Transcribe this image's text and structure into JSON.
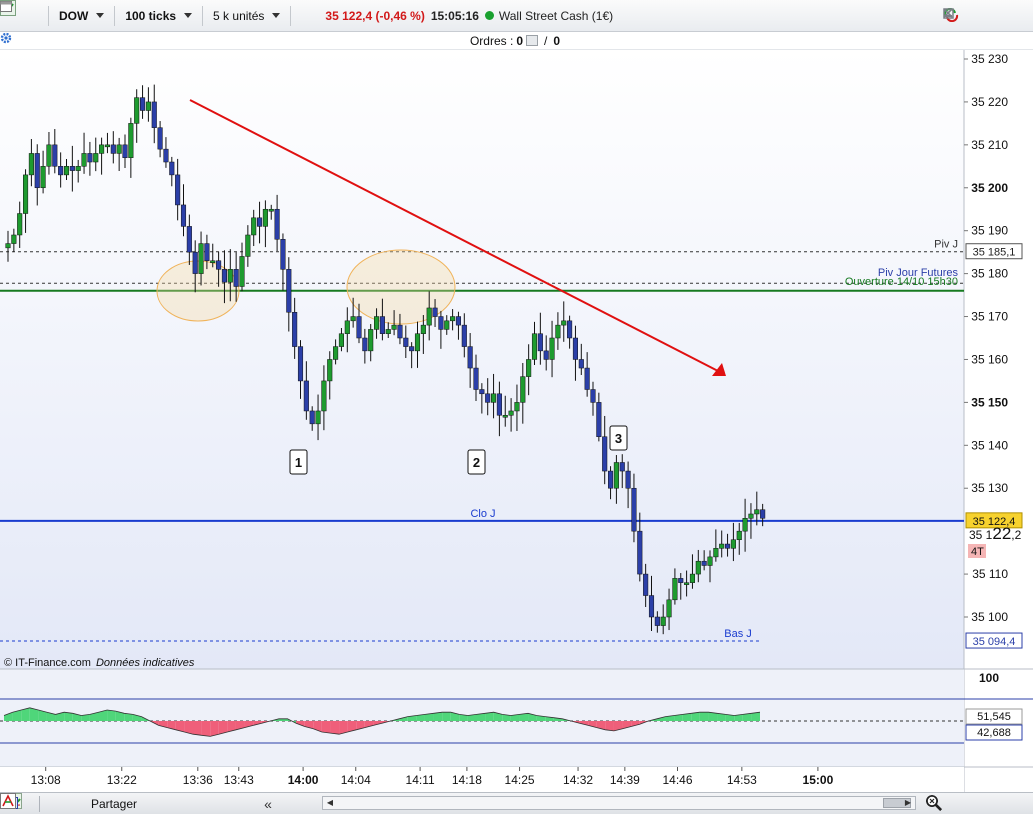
{
  "toolbar": {
    "instrument": "DOW",
    "ticks": "100 ticks",
    "units": "5 k unités",
    "price_change": "35 122,4 (-0,46 %)",
    "time": "15:05:16",
    "instrument_name": "Wall Street Cash (1€)"
  },
  "orders": {
    "label": "Ordres :",
    "count_a": "0",
    "slash": "/",
    "count_b": "0"
  },
  "watermark": "© IT-Finance.com",
  "watermark_note": "Données indicatives",
  "bottom": {
    "share_label": "Partager"
  },
  "colors": {
    "bull": "#1e9b2f",
    "bear": "#2b3fa8",
    "trend": "#e01010",
    "clo": "#1a3ccf",
    "ouverture": "#167a20"
  },
  "chart_data": {
    "type": "candlestick",
    "y_ticks": [
      "35 230",
      "35 220",
      "35 210",
      "35 200",
      "35 190",
      "35 180",
      "35 170",
      "35 160",
      "35 150",
      "35 140",
      "35 130",
      "35 110",
      "35 100"
    ],
    "bold_ticks": [
      "35 200",
      "35 150"
    ],
    "ylim": [
      35088,
      35233
    ],
    "x_ticks": [
      {
        "label": "13:08",
        "i": 2
      },
      {
        "label": "13:22",
        "i": 15
      },
      {
        "label": "13:36",
        "i": 28
      },
      {
        "label": "13:43",
        "i": 35
      },
      {
        "label": "14:00",
        "i": 46,
        "bold": true
      },
      {
        "label": "14:04",
        "i": 55
      },
      {
        "label": "14:11",
        "i": 66
      },
      {
        "label": "14:18",
        "i": 74
      },
      {
        "label": "14:25",
        "i": 83
      },
      {
        "label": "14:32",
        "i": 93
      },
      {
        "label": "14:39",
        "i": 101
      },
      {
        "label": "14:46",
        "i": 110
      },
      {
        "label": "14:53",
        "i": 121
      },
      {
        "label": "15:00",
        "i": 134,
        "bold": true
      }
    ],
    "levels": [
      {
        "name": "Piv J",
        "value": 35185.1,
        "label": "35 185,1"
      },
      {
        "name": "Piv Jour Futures",
        "value": 35178,
        "label": ""
      },
      {
        "name": "Ouverture 14/10 15h30",
        "value": 35176,
        "label": ""
      },
      {
        "name": "Clo J",
        "value": 35122.4,
        "label": "35 122,4"
      },
      {
        "name": "Bas J",
        "value": 35094.4,
        "label": "35 094,4"
      }
    ],
    "last_price": "35 122,4",
    "live_price_main": "35 1",
    "live_price_big": "22",
    "live_price_dec": ",2",
    "tick_count_badge": "4T",
    "annotations": [
      "1",
      "2",
      "3"
    ],
    "oscillator": {
      "top_label": "100",
      "value_a": "51,545",
      "value_b": "42,688"
    },
    "closes": [
      35187,
      35189,
      35194,
      35203,
      35208,
      35200,
      35205,
      35210,
      35205,
      35203,
      35205,
      35204,
      35205,
      35208,
      35206,
      35208,
      35210,
      35210,
      35208,
      35210,
      35207,
      35215,
      35221,
      35218,
      35220,
      35214,
      35209,
      35206,
      35203,
      35196,
      35191,
      35185,
      35180,
      35187,
      35183,
      35183,
      35181,
      35178,
      35181,
      35177,
      35184,
      35189,
      35193,
      35191,
      35195,
      35195,
      35188,
      35181,
      35171,
      35163,
      35155,
      35148,
      35145,
      35148,
      35155,
      35160,
      35163,
      35166,
      35169,
      35170,
      35165,
      35162,
      35167,
      35170,
      35166,
      35167,
      35168,
      35165,
      35163,
      35162,
      35166,
      35168,
      35172,
      35170,
      35167,
      35169,
      35170,
      35168,
      35163,
      35158,
      35153,
      35152,
      35150,
      35152,
      35147,
      35147,
      35148,
      35150,
      35156,
      35160,
      35166,
      35162,
      35160,
      35165,
      35168,
      35169,
      35165,
      35160,
      35158,
      35153,
      35150,
      35142,
      35134,
      35130,
      35136,
      35134,
      35130,
      35120,
      35110,
      35105,
      35100,
      35098,
      35100,
      35104,
      35109,
      35108,
      35108,
      35110,
      35113,
      35112,
      35114,
      35116,
      35117,
      35116,
      35118,
      35120,
      35123,
      35124,
      35125,
      35123
    ],
    "oscillator_values": [
      55,
      58,
      60,
      62,
      60,
      58,
      56,
      58,
      57,
      55,
      56,
      58,
      60,
      59,
      57,
      56,
      54,
      50,
      46,
      44,
      42,
      40,
      38,
      37,
      36,
      38,
      40,
      42,
      44,
      46,
      48,
      50,
      52,
      52,
      48,
      45,
      43,
      40,
      39,
      38,
      40,
      42,
      44,
      46,
      48,
      50,
      52,
      54,
      55,
      56,
      57,
      58,
      58,
      56,
      55,
      56,
      57,
      58,
      56,
      55,
      56,
      57,
      55,
      54,
      53,
      52,
      50,
      48,
      46,
      44,
      42,
      41,
      43,
      45,
      47,
      50,
      52,
      54,
      55,
      56,
      57,
      58,
      58,
      57,
      56,
      55,
      56,
      57,
      58
    ]
  }
}
